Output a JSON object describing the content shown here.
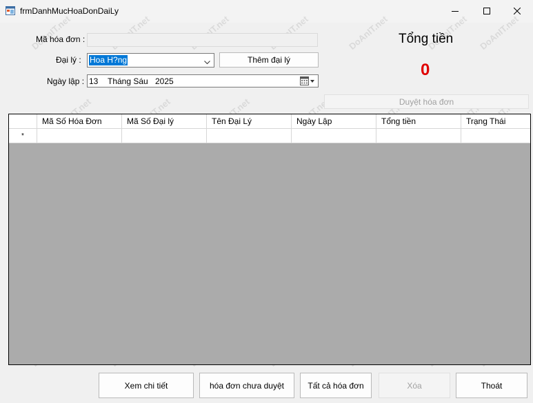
{
  "window": {
    "title": "frmDanhMucHoaDonDaiLy",
    "icon": "form-app-icon",
    "controls": [
      "minimize-icon",
      "maximize-icon",
      "close-icon"
    ]
  },
  "form": {
    "invoice_id_label": "Mã hóa đơn :",
    "invoice_id_value": "",
    "agent_label": "Đại lý :",
    "agent_value": "Hoa H?ng",
    "add_agent_button": "Thêm đại lý",
    "date_label": "Ngày lập :",
    "date_day": "13",
    "date_month": "Tháng Sáu",
    "date_year": "2025"
  },
  "summary": {
    "total_label": "Tổng tiền",
    "total_value": "0",
    "approve_button": "Duyệt hóa đơn"
  },
  "grid": {
    "columns": [
      "Mã Số Hóa Đơn",
      "Mã Số Đại lý",
      "Tên Đại Lý",
      "Ngày Lập",
      "Tổng tiền",
      "Trạng Thái"
    ],
    "new_row_marker": "*"
  },
  "buttons": {
    "details": "Xem chi tiết",
    "unapproved": "hóa đơn chưa duyệt",
    "all": "Tất cả hóa đơn",
    "delete": "Xóa",
    "exit": "Thoát"
  },
  "watermark": "DoAnIT.net",
  "colors": {
    "total_value": "#e00000",
    "grid_background": "#ababab",
    "selection": "#0078d7"
  }
}
